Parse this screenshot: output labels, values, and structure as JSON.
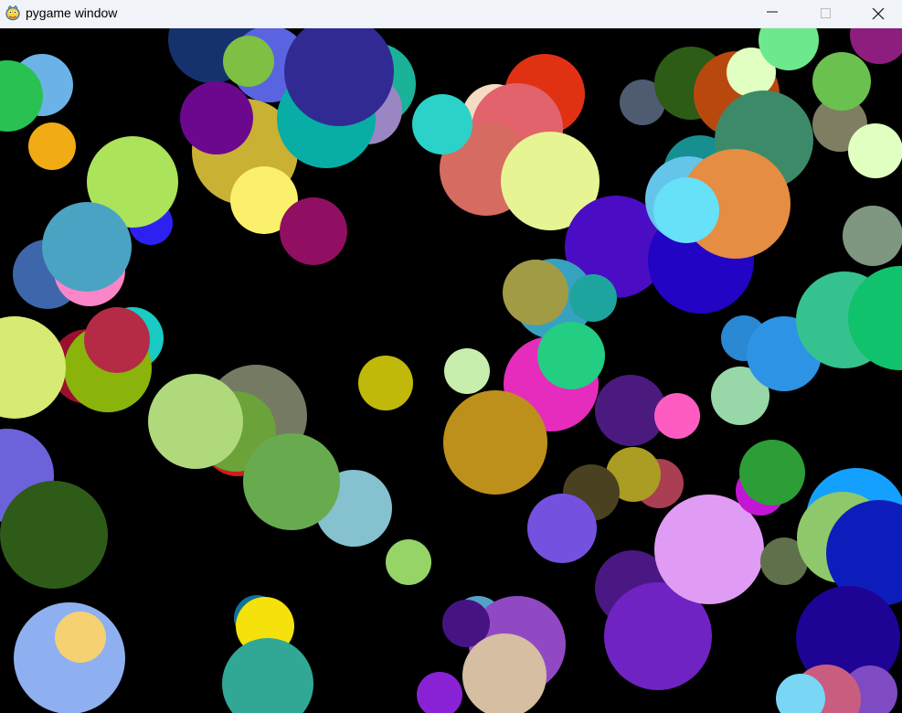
{
  "window": {
    "title": "pygame window",
    "icon": "pygame-snake-icon",
    "controls": {
      "minimize_icon": "minimize-icon",
      "maximize_icon": "maximize-icon",
      "close_icon": "close-icon"
    }
  },
  "game": {
    "background": "#000000",
    "circles": [
      [
        232,
        43,
        48,
        "#16326e"
      ],
      [
        295,
        70,
        42,
        "#5a63e0"
      ],
      [
        272,
        67,
        28,
        "#7fbf43"
      ],
      [
        410,
        92,
        45,
        "#1ab399"
      ],
      [
        402,
        120,
        38,
        "#9b86c4"
      ],
      [
        268,
        166,
        58,
        "#c9b133"
      ],
      [
        357,
        130,
        54,
        "#08ada6"
      ],
      [
        371,
        78,
        60,
        "#312a93"
      ],
      [
        237,
        129,
        40,
        "#6c088e"
      ],
      [
        289,
        219,
        37,
        "#faf06b"
      ],
      [
        343,
        253,
        37,
        "#900f62"
      ],
      [
        46,
        93,
        34,
        "#6bb3e6"
      ],
      [
        8,
        105,
        39,
        "#29c151"
      ],
      [
        57,
        160,
        26,
        "#f0ab15"
      ],
      [
        165,
        244,
        24,
        "#2d21f2"
      ],
      [
        145,
        199,
        50,
        "#abe35b"
      ],
      [
        52,
        300,
        38,
        "#3e67ab"
      ],
      [
        98,
        296,
        39,
        "#fa85c8"
      ],
      [
        95,
        270,
        49,
        "#4aa3c2"
      ],
      [
        145,
        370,
        34,
        "#19cbc2"
      ],
      [
        96,
        401,
        41,
        "#9c0f30"
      ],
      [
        118,
        403,
        48,
        "#8ab40b"
      ],
      [
        128,
        372,
        36,
        "#b52b45"
      ],
      [
        16,
        402,
        56,
        "#d7ea73"
      ],
      [
        280,
        455,
        56,
        "#757b63"
      ],
      [
        260,
        482,
        39,
        "#cc1d1d"
      ],
      [
        258,
        472,
        44,
        "#6ba239"
      ],
      [
        214,
        461,
        52,
        "#b0d97c"
      ],
      [
        387,
        556,
        42,
        "#85c1cf"
      ],
      [
        319,
        527,
        53,
        "#68ab4f"
      ],
      [
        422,
        419,
        30,
        "#c1b90a"
      ],
      [
        447,
        615,
        25,
        "#96d468"
      ],
      [
        511,
        406,
        25,
        "#c8eeae"
      ],
      [
        8,
        520,
        51,
        "#6c63db"
      ],
      [
        59,
        585,
        59,
        "#2f5b19"
      ],
      [
        76,
        720,
        61,
        "#8eb0f0"
      ],
      [
        88,
        697,
        28,
        "#f5d173"
      ],
      [
        281,
        676,
        25,
        "#0f729a"
      ],
      [
        290,
        685,
        32,
        "#f5e10b"
      ],
      [
        293,
        748,
        50,
        "#31a896"
      ],
      [
        523,
        680,
        28,
        "#55a2c7"
      ],
      [
        566,
        705,
        53,
        "#9149c3"
      ],
      [
        510,
        682,
        26,
        "#461482"
      ],
      [
        552,
        739,
        46,
        "#d5bea1"
      ],
      [
        481,
        760,
        25,
        "#8922d4"
      ],
      [
        542,
        129,
        37,
        "#f5dbc4"
      ],
      [
        596,
        103,
        44,
        "#e03212"
      ],
      [
        566,
        141,
        50,
        "#e2636c"
      ],
      [
        532,
        185,
        51,
        "#d56b61"
      ],
      [
        484,
        136,
        33,
        "#2ad2c9"
      ],
      [
        602,
        198,
        54,
        "#e7f493"
      ],
      [
        703,
        112,
        25,
        "#4e5b71"
      ],
      [
        674,
        270,
        56,
        "#4a0dc3"
      ],
      [
        767,
        285,
        58,
        "#2104c4"
      ],
      [
        606,
        327,
        44,
        "#37a1c0"
      ],
      [
        586,
        320,
        36,
        "#a29b46"
      ],
      [
        649,
        326,
        26,
        "#1ea49f"
      ],
      [
        603,
        420,
        52,
        "#e62cbc"
      ],
      [
        625,
        389,
        37,
        "#23cd81"
      ],
      [
        542,
        484,
        57,
        "#bd901c"
      ],
      [
        690,
        449,
        39,
        "#4b1a7e"
      ],
      [
        741,
        455,
        25,
        "#fe5cc1"
      ],
      [
        810,
        433,
        32,
        "#98d8a8"
      ],
      [
        814,
        370,
        25,
        "#2b88d2"
      ],
      [
        858,
        387,
        41,
        "#2d93e4"
      ],
      [
        721,
        529,
        27,
        "#aa3e53"
      ],
      [
        693,
        519,
        30,
        "#ab9c23"
      ],
      [
        647,
        539,
        31,
        "#49411f"
      ],
      [
        615,
        578,
        38,
        "#7551e0"
      ],
      [
        692,
        643,
        41,
        "#4a1882"
      ],
      [
        720,
        696,
        59,
        "#7023c3"
      ],
      [
        776,
        601,
        60,
        "#e09bf5"
      ],
      [
        832,
        537,
        27,
        "#c315d4"
      ],
      [
        845,
        517,
        36,
        "#2c9d37"
      ],
      [
        858,
        614,
        26,
        "#5f714a"
      ],
      [
        756,
        91,
        40,
        "#2c5c16"
      ],
      [
        806,
        103,
        47,
        "#b9480f"
      ],
      [
        822,
        79,
        27,
        "#e0ffc0"
      ],
      [
        766,
        188,
        40,
        "#168f90"
      ],
      [
        836,
        153,
        54,
        "#3c8a6a"
      ],
      [
        753,
        218,
        47,
        "#65c4ea"
      ],
      [
        805,
        223,
        60,
        "#e58d42"
      ],
      [
        751,
        230,
        36,
        "#66e1f8"
      ],
      [
        863,
        44,
        33,
        "#6ee88c"
      ],
      [
        962,
        38,
        32,
        "#8d1e7d"
      ],
      [
        919,
        136,
        30,
        "#807e62"
      ],
      [
        921,
        89,
        32,
        "#6bc14f"
      ],
      [
        958,
        165,
        30,
        "#e0ffc0"
      ],
      [
        955,
        258,
        33,
        "#7f9680"
      ],
      [
        924,
        350,
        53,
        "#36c28f"
      ],
      [
        985,
        348,
        57,
        "#10c26b"
      ],
      [
        937,
        567,
        55,
        "#14a0ff"
      ],
      [
        922,
        588,
        50,
        "#8fc86a"
      ],
      [
        962,
        605,
        58,
        "#0d1dbc"
      ],
      [
        928,
        698,
        57,
        "#1f0394"
      ],
      [
        952,
        758,
        30,
        "#7f4bc3"
      ],
      [
        904,
        765,
        38,
        "#c95d80"
      ],
      [
        876,
        764,
        27,
        "#7ad6f5"
      ]
    ]
  }
}
